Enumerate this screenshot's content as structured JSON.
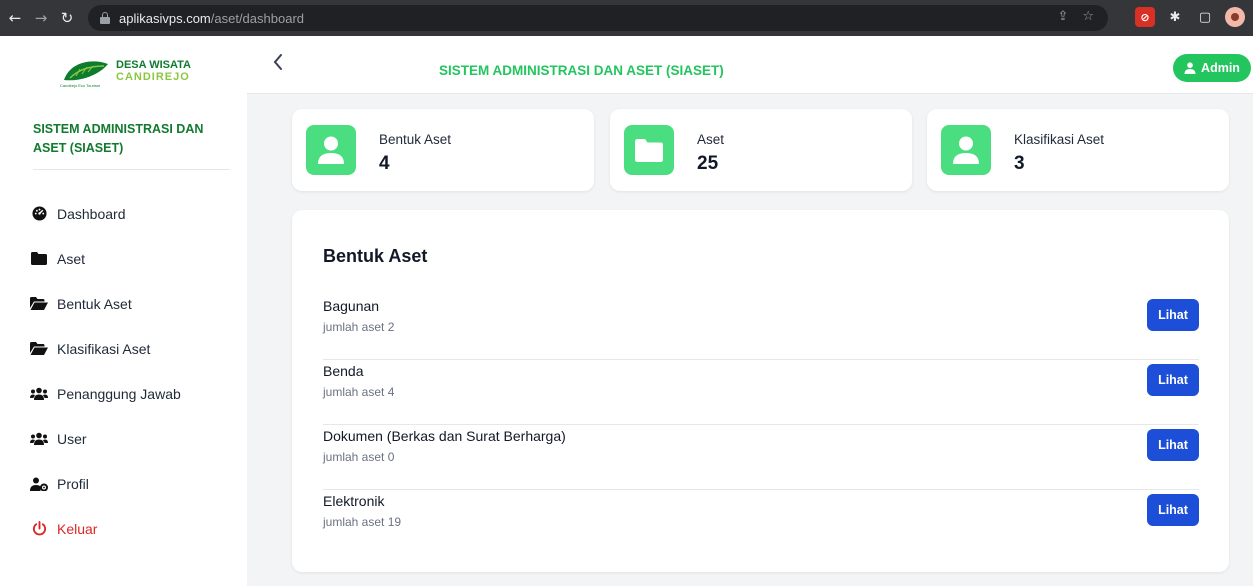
{
  "browser": {
    "url_host": "aplikasivps.com",
    "url_path": "/aset/dashboard"
  },
  "sidebar": {
    "logo_line1": "DESA WISATA",
    "logo_line2": "CANDIREJO",
    "logo_tagline": "Candirejo Eco Tourism",
    "system_title": "SISTEM ADMINISTRASI DAN ASET (SIASET)",
    "items": [
      {
        "label": "Dashboard",
        "icon": "dashboard-icon"
      },
      {
        "label": "Aset",
        "icon": "folder-icon"
      },
      {
        "label": "Bentuk Aset",
        "icon": "folder-open-icon"
      },
      {
        "label": "Klasifikasi Aset",
        "icon": "folder-open-icon"
      },
      {
        "label": "Penanggung Jawab",
        "icon": "users-icon"
      },
      {
        "label": "User",
        "icon": "users-icon"
      },
      {
        "label": "Profil",
        "icon": "user-cog-icon"
      },
      {
        "label": "Keluar",
        "icon": "power-icon"
      }
    ]
  },
  "header": {
    "title": "SISTEM ADMINISTRASI DAN ASET (SIASET)",
    "admin_label": "Admin"
  },
  "stats": [
    {
      "label": "Bentuk Aset",
      "value": "4",
      "icon": "user-icon"
    },
    {
      "label": "Aset",
      "value": "25",
      "icon": "folder-icon"
    },
    {
      "label": "Klasifikasi Aset",
      "value": "3",
      "icon": "user-icon"
    }
  ],
  "panel": {
    "title": "Bentuk Aset",
    "rows": [
      {
        "name": "Bagunan",
        "sub": "jumlah aset 2",
        "button": "Lihat"
      },
      {
        "name": "Benda",
        "sub": "jumlah aset 4",
        "button": "Lihat"
      },
      {
        "name": "Dokumen (Berkas dan Surat Berharga)",
        "sub": "jumlah aset 0",
        "button": "Lihat"
      },
      {
        "name": "Elektronik",
        "sub": "jumlah aset 19",
        "button": "Lihat"
      }
    ]
  },
  "colors": {
    "accent_green": "#22c55e",
    "card_icon_green": "#4ade80",
    "brand_dark_green": "#127a2f",
    "button_blue": "#1d4ed8",
    "logout_red": "#dc2626"
  }
}
